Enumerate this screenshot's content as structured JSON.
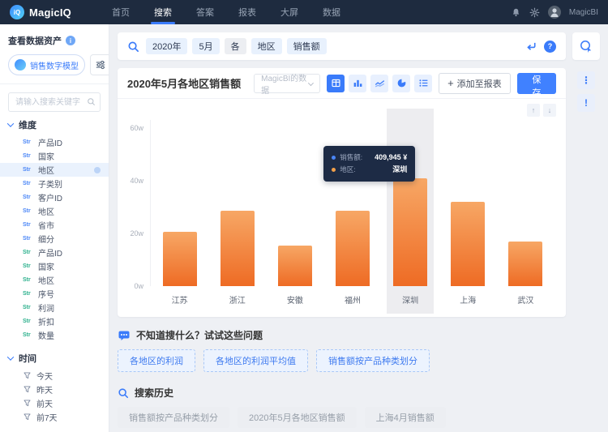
{
  "navbar": {
    "logo_text": "MagicIQ",
    "items": [
      {
        "label": "首页",
        "active": false
      },
      {
        "label": "搜索",
        "active": true
      },
      {
        "label": "答案",
        "active": false
      },
      {
        "label": "报表",
        "active": false
      },
      {
        "label": "大屏",
        "active": false
      },
      {
        "label": "数据",
        "active": false
      }
    ],
    "user_name": "MagicBI"
  },
  "sidebar": {
    "assets_title": "查看数据资产",
    "model_label": "销售数字模型",
    "search_placeholder": "请输入搜索关键字",
    "dim_section_title": "维度",
    "dims": [
      {
        "prefix": "Str",
        "label": "产品ID",
        "type": "blue"
      },
      {
        "prefix": "Str",
        "label": "国家",
        "type": "blue"
      },
      {
        "prefix": "Str",
        "label": "地区",
        "type": "blue",
        "selected": true
      },
      {
        "prefix": "Str",
        "label": "子类别",
        "type": "blue"
      },
      {
        "prefix": "Str",
        "label": "客户ID",
        "type": "blue"
      },
      {
        "prefix": "Str",
        "label": "地区",
        "type": "blue"
      },
      {
        "prefix": "Str",
        "label": "省市",
        "type": "blue"
      },
      {
        "prefix": "Str",
        "label": "细分",
        "type": "blue"
      },
      {
        "prefix": "Str",
        "label": "产品ID",
        "type": "green"
      },
      {
        "prefix": "Str",
        "label": "国家",
        "type": "green"
      },
      {
        "prefix": "Str",
        "label": "地区",
        "type": "green"
      },
      {
        "prefix": "Str",
        "label": "序号",
        "type": "green"
      },
      {
        "prefix": "Str",
        "label": "利润",
        "type": "green"
      },
      {
        "prefix": "Str",
        "label": "折扣",
        "type": "green"
      },
      {
        "prefix": "Str",
        "label": "数量",
        "type": "green"
      }
    ],
    "time_section_title": "时间",
    "time_items": [
      "今天",
      "昨天",
      "前天",
      "前7天"
    ]
  },
  "search_bar": {
    "tags": [
      {
        "text": "2020年",
        "style": "blue"
      },
      {
        "text": "5月",
        "style": "blue"
      },
      {
        "text": "各",
        "style": "gray"
      },
      {
        "text": "地区",
        "style": "blue"
      },
      {
        "text": "销售额",
        "style": "blue"
      }
    ]
  },
  "chart_header": {
    "datasource": "MagicBI的数据",
    "add_label": "添加至报表",
    "save_label": "保存"
  },
  "chart_data": {
    "type": "bar",
    "title": "2020年5月各地区销售额",
    "categories": [
      "江苏",
      "浙江",
      "安徽",
      "福州",
      "深圳",
      "上海",
      "武汉"
    ],
    "values": [
      20.5,
      28.5,
      15.5,
      28.5,
      41,
      32,
      17
    ],
    "unit": "w",
    "xlabel": "",
    "ylabel": "",
    "ylim": [
      0,
      60
    ],
    "yticks": [
      "0w",
      "20w",
      "40w",
      "60w"
    ],
    "grid": false,
    "legend": "none",
    "bar_color_top": "#f7a765",
    "bar_color_bottom": "#ee6b24",
    "highlighted": "深圳",
    "tooltip": {
      "sales_label": "销售额:",
      "sales_value": "409,945 ¥",
      "region_label": "地区:",
      "region_value": "深圳"
    }
  },
  "suggest": {
    "title": "不知道搜什么？试试这些问题",
    "chips": [
      "各地区的利润",
      "各地区的利润平均值",
      "销售额按产品种类划分"
    ]
  },
  "history": {
    "title": "搜索历史",
    "chips": [
      "销售额按产品种类划分",
      "2020年5月各地区销售额",
      "上海4月销售额"
    ]
  },
  "icons": {
    "info": "i",
    "help": "?",
    "plus": "+",
    "more": "⋮",
    "alert": "!",
    "sort_up": "↑",
    "sort_down": "↓"
  },
  "colors": {
    "accent": "#3a7bfa",
    "navbar_bg": "#1e2b3f",
    "save_button": "#4081ff",
    "tooltip_bg": "#1d2b45",
    "highlight_band": "#ededf0"
  }
}
